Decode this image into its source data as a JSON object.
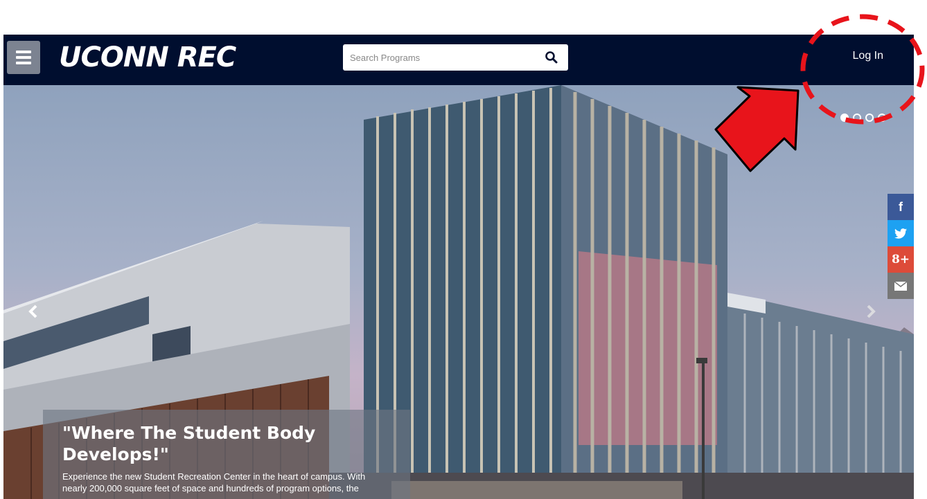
{
  "nav": {
    "logo_text": "UCONN REC",
    "search_placeholder": "Search Programs",
    "login_label": "Log In"
  },
  "hero": {
    "slide_count": 4,
    "active_slide": 1,
    "caption_title": "\"Where The Student Body Develops!\"",
    "caption_text": "Experience the new Student Recreation Center in the heart of campus. With nearly 200,000 square feet of space and hundreds of program options, the"
  },
  "share": {
    "facebook_glyph": "f",
    "google_glyph": "8+"
  },
  "colors": {
    "navbar": "#000e2f",
    "annotation": "#e8141b"
  }
}
